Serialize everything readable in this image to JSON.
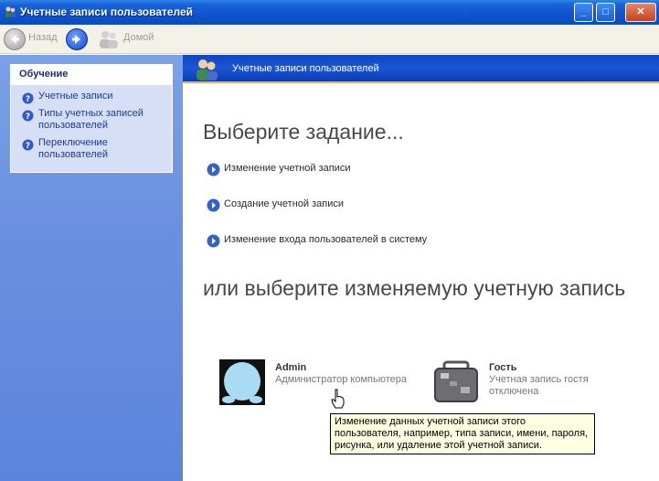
{
  "window": {
    "title": "Учетные записи пользователей",
    "buttons": {
      "minimize": "_",
      "maximize": "□",
      "close": "✕"
    }
  },
  "toolbar": {
    "back_label": "Назад",
    "home_label": "Домой"
  },
  "sidebar": {
    "panel_title": "Обучение",
    "items": [
      {
        "label": "Учетные записи"
      },
      {
        "label": "Типы учетных записей пользователей"
      },
      {
        "label": "Переключение пользователей"
      }
    ]
  },
  "header": {
    "title": "Учетные записи пользователей"
  },
  "main": {
    "heading": "Выберите задание...",
    "tasks": [
      {
        "label": "Изменение учетной записи"
      },
      {
        "label": "Создание учетной записи"
      },
      {
        "label": "Изменение входа пользователей в систему"
      }
    ],
    "subheading": "или выберите изменяемую учетную запись",
    "accounts": [
      {
        "name": "Admin",
        "description": "Администратор компьютера"
      },
      {
        "name": "Гость",
        "description": "Учетная запись гостя отключена"
      }
    ]
  },
  "tooltip": {
    "text": "Изменение данных учетной записи этого пользователя, например, типа записи, имени, пароля, рисунка, или удаление этой учетной записи."
  }
}
